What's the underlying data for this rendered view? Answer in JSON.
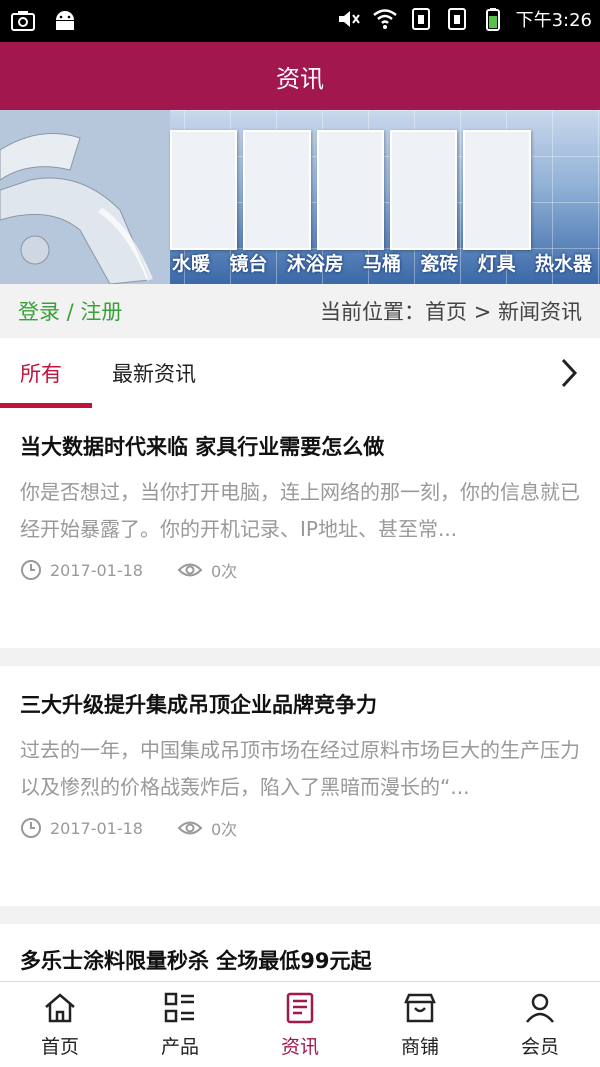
{
  "status_bar": {
    "time": "下午3:26"
  },
  "header": {
    "title": "资讯"
  },
  "banner": {
    "categories": [
      "水暖",
      "镜台",
      "沐浴房",
      "马桶",
      "瓷砖",
      "灯具",
      "热水器"
    ]
  },
  "crumb_bar": {
    "login_label": "登录 / 注册",
    "location_label": "当前位置：首页 > 新闻资讯"
  },
  "tabs": [
    {
      "label": "所有",
      "active": true
    },
    {
      "label": "最新资讯",
      "active": false
    }
  ],
  "news": [
    {
      "title": "当大数据时代来临 家具行业需要怎么做",
      "summary": "你是否想过，当你打开电脑，连上网络的那一刻，你的信息就已经开始暴露了。你的开机记录、IP地址、甚至常...",
      "date": "2017-01-18",
      "views": "0次"
    },
    {
      "title": "三大升级提升集成吊顶企业品牌竞争力",
      "summary": "过去的一年，中国集成吊顶市场在经过原料市场巨大的生产压力以及惨烈的价格战轰炸后，陷入了黑暗而漫长的“...",
      "date": "2017-01-18",
      "views": "0次"
    },
    {
      "title": "多乐士涂料限量秒杀 全场最低99元起"
    }
  ],
  "bottom_nav": [
    {
      "label": "首页",
      "icon": "home-icon"
    },
    {
      "label": "产品",
      "icon": "product-grid-icon"
    },
    {
      "label": "资讯",
      "icon": "news-icon",
      "active": true
    },
    {
      "label": "商铺",
      "icon": "shop-icon"
    },
    {
      "label": "会员",
      "icon": "user-icon"
    }
  ],
  "colors": {
    "brand": "#a3174f",
    "accent": "#c0143c",
    "login": "#3aa13a"
  }
}
